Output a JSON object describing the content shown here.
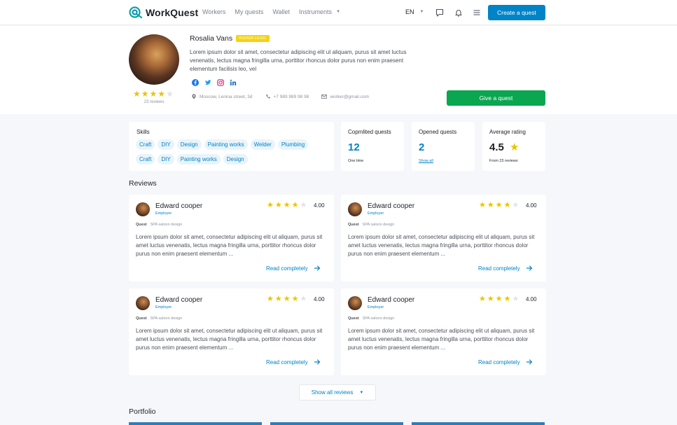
{
  "brand": {
    "name": "WorkQuest",
    "accent": "#0083c7",
    "green": "#0aa650",
    "star": "#e8c500"
  },
  "nav": {
    "items": [
      "Workers",
      "My quests",
      "Wallet",
      "Instruments"
    ]
  },
  "header": {
    "lang": "EN",
    "create_label": "Create a quest"
  },
  "profile": {
    "name": "Rosalia Vans",
    "level": "HIGHER LEVEL",
    "description": "Lorem ipsum dolor sit amet, consectetur adipiscing elit ut aliquam, purus sit amet luctus venenatis, lectus magna fringilla urna, porttitor rhoncus dolor purus non enim praesent elementum facilisis leo, vel",
    "rating": 4,
    "reviews_count": "23 reviews",
    "address": "Moscow, Lenina street, 3d",
    "phone": "+7 989 989 98 98",
    "email": "worker@gmail.com",
    "give_label": "Give a quest",
    "socials": [
      "facebook-icon",
      "twitter-icon",
      "instagram-icon",
      "linkedin-icon"
    ]
  },
  "skills": {
    "title": "Skills",
    "items": [
      "Craft",
      "DIY",
      "Design",
      "Painting works",
      "Welder",
      "Plumbing",
      "Craft",
      "DIY",
      "Painting works",
      "Design"
    ]
  },
  "stats": {
    "completed": {
      "title": "Copmlited quests",
      "value": "12",
      "sub": "One time"
    },
    "opened": {
      "title": "Opened quests",
      "value": "2",
      "link": "Show all"
    },
    "average": {
      "title": "Average rating",
      "value": "4.5",
      "sub": "From 23 reviews"
    }
  },
  "reviews_section": {
    "title": "Reviews",
    "show_all_label": "Show all reviews",
    "read_label": "Read completely",
    "items": [
      {
        "name": "Edward cooper",
        "role": "Employer",
        "rating": 4,
        "score": "4.00",
        "quest_label": "Quest",
        "quest": "SPA saloon design",
        "text": "Lorem ipsum dolor sit amet, consectetur adipiscing elit ut aliquam, purus sit amet luctus venenatis, lectus magna fringilla urna, porttitor rhoncus dolor purus non enim praesent elementum ..."
      },
      {
        "name": "Edward cooper",
        "role": "Employer",
        "rating": 4,
        "score": "4.00",
        "quest_label": "Quest",
        "quest": "SPA saloon design",
        "text": "Lorem ipsum dolor sit amet, consectetur adipiscing elit ut aliquam, purus sit amet luctus venenatis, lectus magna fringilla urna, porttitor rhoncus dolor purus non enim praesent elementum ..."
      },
      {
        "name": "Edward cooper",
        "role": "Employer",
        "rating": 4,
        "score": "4.00",
        "quest_label": "Quest",
        "quest": "SPA saloon design",
        "text": "Lorem ipsum dolor sit amet, consectetur adipiscing elit ut aliquam, purus sit amet luctus venenatis, lectus magna fringilla urna, porttitor rhoncus dolor purus non enim praesent elementum ..."
      },
      {
        "name": "Edward cooper",
        "role": "Employer",
        "rating": 4,
        "score": "4.00",
        "quest_label": "Quest",
        "quest": "SPA saloon design",
        "text": "Lorem ipsum dolor sit amet, consectetur adipiscing elit ut aliquam, purus sit amet luctus venenatis, lectus magna fringilla urna, porttitor rhoncus dolor purus non enim praesent elementum ..."
      }
    ]
  },
  "portfolio": {
    "title": "Portfolio"
  }
}
